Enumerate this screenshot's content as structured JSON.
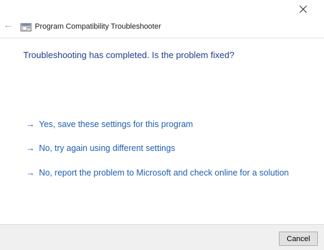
{
  "window": {
    "title": "Program Compatibility Troubleshooter"
  },
  "main": {
    "heading": "Troubleshooting has completed.  Is the problem fixed?",
    "options": [
      {
        "arrow": "→",
        "label": "Yes, save these settings for this program"
      },
      {
        "arrow": "→",
        "label": "No, try again using different settings"
      },
      {
        "arrow": "→",
        "label": "No, report the problem to Microsoft and check online for a solution"
      }
    ]
  },
  "footer": {
    "cancel_label": "Cancel"
  },
  "icons": {
    "back": "back-arrow-icon",
    "close": "close-icon",
    "app": "troubleshooter-icon"
  },
  "colors": {
    "heading": "#1e3f8a",
    "link": "#1f5fb0",
    "footer_bg": "#f0f0f0"
  }
}
